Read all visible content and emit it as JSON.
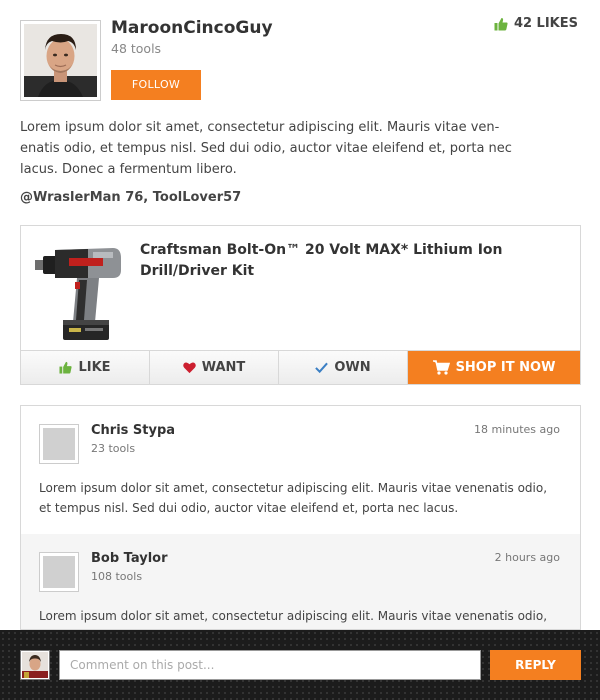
{
  "profile": {
    "username": "MaroonCincoGuy",
    "tools": "48 tools",
    "follow_label": "FOLLOW",
    "likes_label": "42 LIKES",
    "avatar_icon": "user-photo"
  },
  "post": {
    "description": "Lorem ipsum dolor sit amet, consectetur adipiscing elit. Mauris vitae ven-enatis odio, et tempus nisl. Sed dui odio, auctor vitae eleifend et, porta nec lacus. Donec a fermentum libero.",
    "mentions": "@WraslerMan 76, ToolLover57"
  },
  "product": {
    "title": "Craftsman Bolt-On™ 20 Volt MAX* Lithium Ion Drill/Driver Kit",
    "image_icon": "drill-image",
    "actions": {
      "like": "LIKE",
      "want": "WANT",
      "own": "OWN",
      "shop": "SHOP IT NOW"
    }
  },
  "comments": [
    {
      "name": "Chris Stypa",
      "tools": "23 tools",
      "time": "18 minutes ago",
      "text": "Lorem ipsum dolor sit amet, consectetur adipiscing elit. Mauris vitae venenatis odio, et tempus nisl. Sed dui odio, auctor vitae eleifend et, porta nec lacus."
    },
    {
      "name": "Bob Taylor",
      "tools": "108 tools",
      "time": "2 hours ago",
      "text": "Lorem ipsum dolor sit amet, consectetur adipiscing elit. Mauris vitae venenatis odio, et tempus nisl. Sed dui odio, auctor vitae eleifend et, porta nec lacus."
    }
  ],
  "footer": {
    "placeholder": "Comment on this post...",
    "reply_label": "REPLY"
  },
  "colors": {
    "accent": "#f47f20",
    "like_green": "#6cb33f",
    "want_red": "#cc1f2f",
    "own_blue": "#3b7fc4",
    "footer_bg": "#1c1c1c"
  }
}
